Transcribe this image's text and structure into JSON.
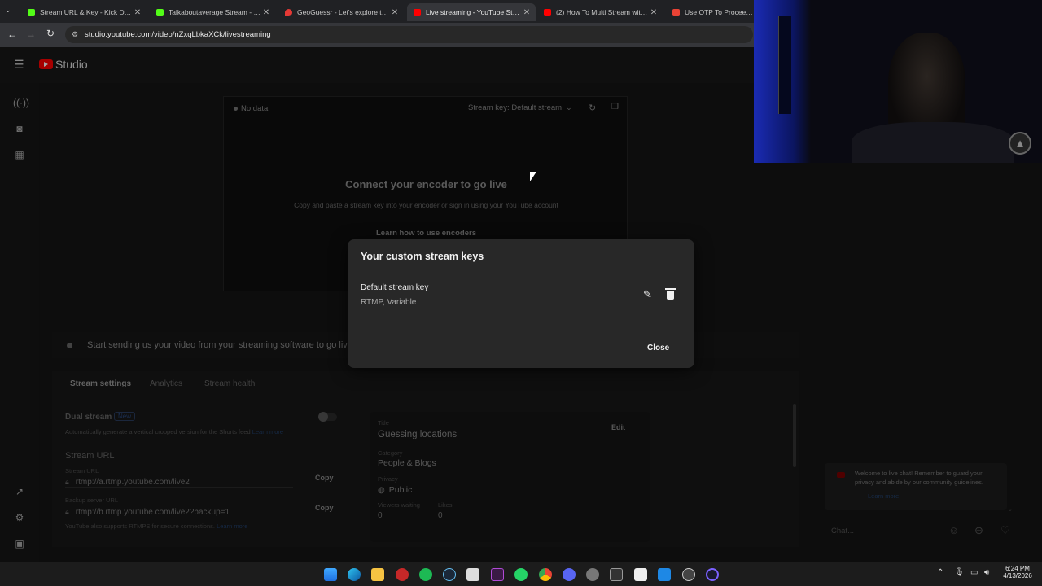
{
  "browser": {
    "tabs": [
      {
        "label": "Stream URL & Key - Kick Dashb",
        "color": "#53fc18"
      },
      {
        "label": "Talkaboutaverage Stream - Wat",
        "color": "#53fc18"
      },
      {
        "label": "GeoGuessr - Let's explore the w",
        "color": "#e53935"
      },
      {
        "label": "Live streaming - YouTube Studi",
        "color": "#ff0000",
        "active": true
      },
      {
        "label": "(2) How To Multi Stream with O",
        "color": "#ff0000"
      },
      {
        "label": "Use OTP To Proceed - ns",
        "color": "#ea4335"
      }
    ],
    "url": "studio.youtube.com/video/nZxqLbkaXCk/livestreaming"
  },
  "studio": {
    "logo_text": "Studio",
    "encoder": {
      "status": "No data",
      "stream_key_selector": "Stream key: Default stream",
      "heading": "Connect your encoder to go live",
      "subtext": "Copy and paste a stream key into your encoder or sign in using your YouTube account",
      "learn_link": "Learn how to use encoders"
    },
    "status_message": "Start sending us your video from your streaming software to go live",
    "tabs": [
      "Stream settings",
      "Analytics",
      "Stream health"
    ],
    "dual_stream": {
      "label": "Dual stream",
      "badge": "New",
      "description": "Automatically generate a vertical cropped version for the Shorts feed",
      "learn_more": "Learn more"
    },
    "stream_url": {
      "section_title": "Stream URL",
      "url_label": "Stream URL",
      "url_value": "rtmp://a.rtmp.youtube.com/live2",
      "backup_label": "Backup server URL",
      "backup_value": "rtmp://b.rtmp.youtube.com/live2?backup=1",
      "copy": "Copy",
      "footer": "YouTube also supports RTMPS for secure connections.",
      "footer_link": "Learn more"
    },
    "details": {
      "title_label": "Title",
      "title": "Guessing locations",
      "edit": "Edit",
      "category_label": "Category",
      "category": "People & Blogs",
      "privacy_label": "Privacy",
      "privacy": "Public",
      "viewers_label": "Viewers waiting",
      "viewers": "0",
      "likes_label": "Likes",
      "likes": "0"
    }
  },
  "dialog": {
    "title": "Your custom stream keys",
    "key_name": "Default stream key",
    "key_meta": "RTMP, Variable",
    "close": "Close"
  },
  "chat": {
    "welcome": "Welcome to live chat! Remember to guard your privacy and abide by our community guidelines.",
    "learn_more": "Learn more",
    "placeholder": "Chat..."
  },
  "taskbar": {
    "time": "6:24 PM",
    "date": "4/13/2026"
  }
}
